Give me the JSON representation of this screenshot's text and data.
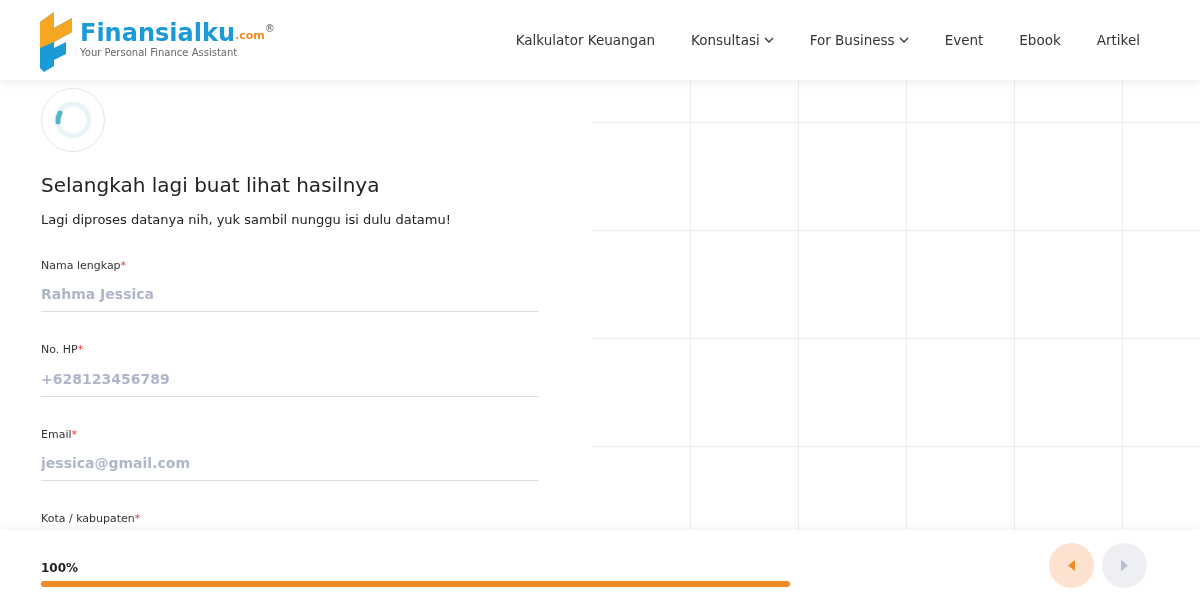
{
  "logo": {
    "name": "Finansialku",
    "domain": ".com",
    "mark": "®",
    "tagline": "Your Personal Finance Assistant"
  },
  "nav": [
    {
      "label": "Kalkulator Keuangan",
      "dropdown": false
    },
    {
      "label": "Konsultasi",
      "dropdown": true
    },
    {
      "label": "For Business",
      "dropdown": true
    },
    {
      "label": "Event",
      "dropdown": false
    },
    {
      "label": "Ebook",
      "dropdown": false
    },
    {
      "label": "Artikel",
      "dropdown": false
    }
  ],
  "form": {
    "title": "Selangkah lagi buat lihat hasilnya",
    "subtitle": "Lagi diproses datanya nih, yuk sambil nunggu isi dulu datamu!",
    "fields": [
      {
        "label": "Nama lengkap",
        "required_mark": "*",
        "placeholder": "Rahma Jessica"
      },
      {
        "label": "No. HP",
        "required_mark": "*",
        "placeholder": "+628123456789"
      },
      {
        "label": "Email",
        "required_mark": "*",
        "placeholder": "jessica@gmail.com"
      },
      {
        "label": "Kota / kabupaten",
        "required_mark": "*"
      }
    ]
  },
  "footer": {
    "progress_label": "100%",
    "level": 1.0,
    "buttons": [
      {
        "kind": "prev",
        "disabled": false
      },
      {
        "kind": "next",
        "disabled": true
      }
    ]
  }
}
